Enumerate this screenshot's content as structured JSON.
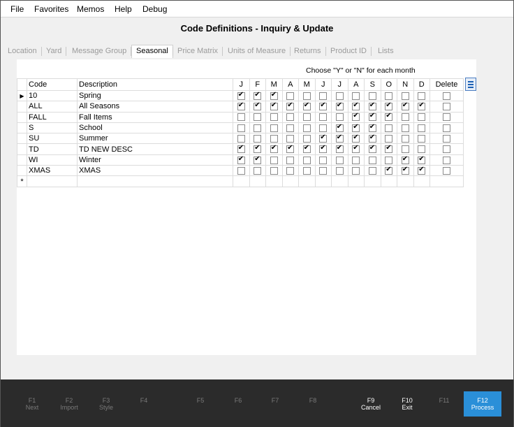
{
  "menu": [
    "File",
    "Favorites",
    "Memos",
    "Help",
    "Debug"
  ],
  "title": "Code Definitions - Inquiry & Update",
  "tabs": [
    "Location",
    "Yard",
    "Message Group",
    "Seasonal",
    "Price Matrix",
    "Units of Measure",
    "Returns",
    "Product ID",
    "Lists"
  ],
  "active_tab": "Seasonal",
  "hint": "Choose \"Y\" or \"N\" for each month",
  "columns": {
    "code": "Code",
    "description": "Description",
    "months": [
      "J",
      "F",
      "M",
      "A",
      "M",
      "J",
      "J",
      "A",
      "S",
      "O",
      "N",
      "D"
    ],
    "delete": "Delete"
  },
  "rows": [
    {
      "code": "10",
      "description": "Spring",
      "months": [
        1,
        1,
        1,
        0,
        0,
        0,
        0,
        0,
        0,
        0,
        0,
        0
      ],
      "delete": 0
    },
    {
      "code": "ALL",
      "description": "All Seasons",
      "months": [
        1,
        1,
        1,
        1,
        1,
        1,
        1,
        1,
        1,
        1,
        1,
        1
      ],
      "delete": 0
    },
    {
      "code": "FALL",
      "description": "Fall Items",
      "months": [
        0,
        0,
        0,
        0,
        0,
        0,
        0,
        1,
        1,
        1,
        0,
        0
      ],
      "delete": 0
    },
    {
      "code": "S",
      "description": "School",
      "months": [
        0,
        0,
        0,
        0,
        0,
        0,
        1,
        1,
        1,
        0,
        0,
        0
      ],
      "delete": 0
    },
    {
      "code": "SU",
      "description": "Summer",
      "months": [
        0,
        0,
        0,
        0,
        0,
        1,
        1,
        1,
        1,
        0,
        0,
        0
      ],
      "delete": 0
    },
    {
      "code": "TD",
      "description": "TD NEW DESC",
      "months": [
        1,
        1,
        1,
        1,
        1,
        1,
        1,
        1,
        1,
        1,
        0,
        0
      ],
      "delete": 0
    },
    {
      "code": "WI",
      "description": "Winter",
      "months": [
        1,
        1,
        0,
        0,
        0,
        0,
        0,
        0,
        0,
        0,
        1,
        1
      ],
      "delete": 0
    },
    {
      "code": "XMAS",
      "description": "XMAS",
      "months": [
        0,
        0,
        0,
        0,
        0,
        0,
        0,
        0,
        0,
        1,
        1,
        1
      ],
      "delete": 0
    }
  ],
  "new_row_marker": "*",
  "fkeys": [
    {
      "key": "F1",
      "label": "Next",
      "enabled": false
    },
    {
      "key": "F2",
      "label": "Import",
      "enabled": false
    },
    {
      "key": "F3",
      "label": "Style",
      "enabled": false
    },
    {
      "key": "F4",
      "label": "",
      "enabled": false
    },
    {
      "key": "F5",
      "label": "",
      "enabled": false
    },
    {
      "key": "F6",
      "label": "",
      "enabled": false
    },
    {
      "key": "F7",
      "label": "",
      "enabled": false
    },
    {
      "key": "F8",
      "label": "",
      "enabled": false
    },
    {
      "key": "F9",
      "label": "Cancel",
      "enabled": true
    },
    {
      "key": "F10",
      "label": "Exit",
      "enabled": true
    },
    {
      "key": "F11",
      "label": "",
      "enabled": false
    },
    {
      "key": "F12",
      "label": "Process",
      "enabled": true
    }
  ],
  "colors": {
    "accent": "#2a8fd8",
    "footer": "#2b2b2b"
  }
}
